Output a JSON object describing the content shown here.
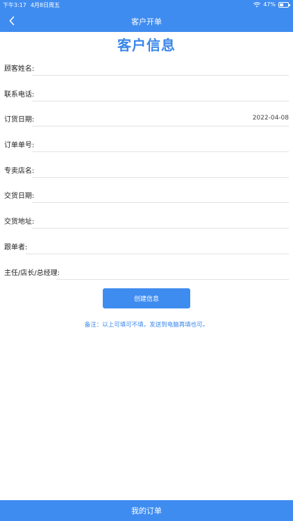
{
  "status": {
    "time": "下午3:17",
    "date": "4月8日周五",
    "battery": "47%"
  },
  "nav": {
    "title": "客户开单",
    "back_icon": "chevron-left-icon"
  },
  "page": {
    "title": "客户信息"
  },
  "form": {
    "customer_name": {
      "label": "顾客姓名:",
      "value": ""
    },
    "phone": {
      "label": "联系电话:",
      "value": ""
    },
    "order_date": {
      "label": "订货日期:",
      "value": "2022-04-08"
    },
    "order_number": {
      "label": "订单单号:",
      "value": ""
    },
    "store_name": {
      "label": "专卖店名:",
      "value": ""
    },
    "delivery_date": {
      "label": "交货日期:",
      "value": ""
    },
    "delivery_address": {
      "label": "交货地址:",
      "value": ""
    },
    "follower": {
      "label": "跟单者:",
      "value": ""
    },
    "manager": {
      "label": "主任/店长/总经理:",
      "value": ""
    }
  },
  "actions": {
    "create_label": "创建信息"
  },
  "note": "备注：以上可填可不填，发送到电脑再填也可。",
  "footer": {
    "my_orders": "我的订单"
  },
  "colors": {
    "primary": "#3f8cf0",
    "accent_text": "#3a86ea"
  }
}
